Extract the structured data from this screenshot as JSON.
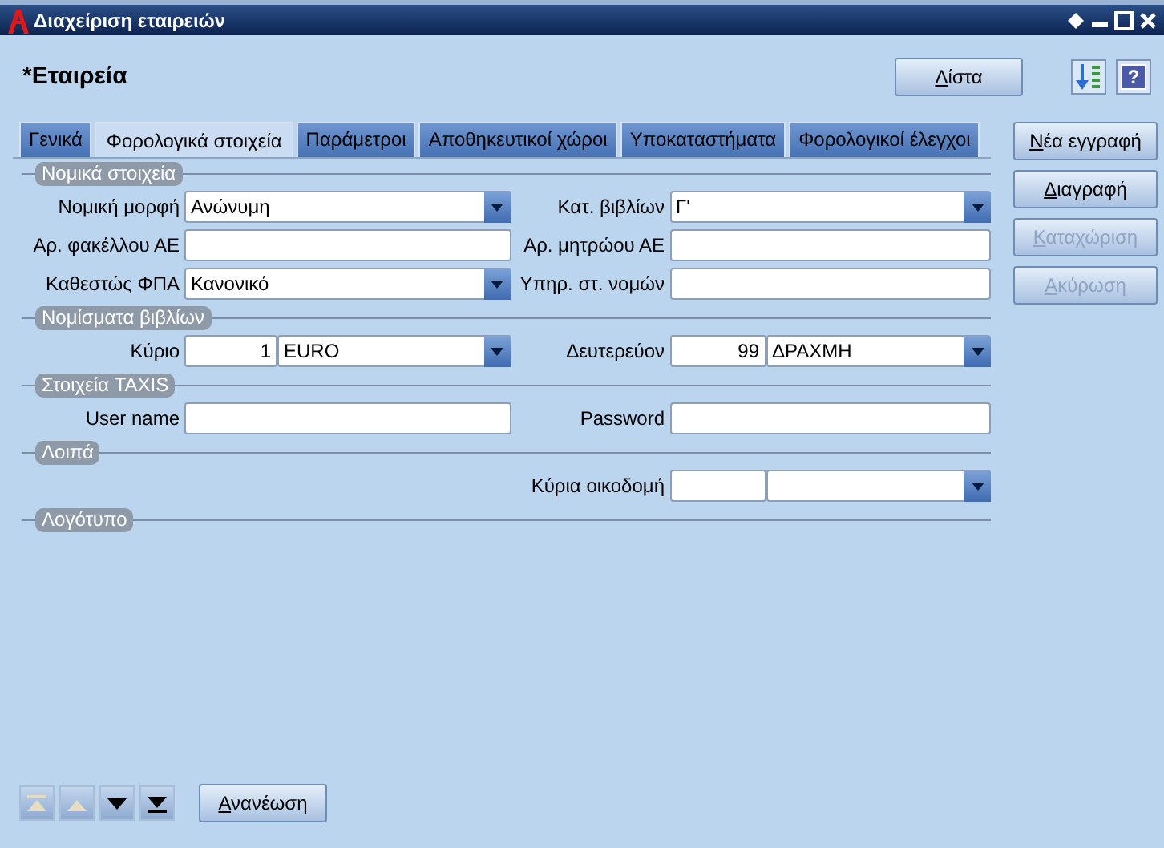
{
  "window": {
    "title": "Διαχείριση εταιρειών"
  },
  "heading": "*Εταιρεία",
  "list_button": "Λίστα",
  "help_label": "?",
  "tabs": [
    {
      "label": "Γενικά",
      "selected": false
    },
    {
      "label": "Φορολογικά στοιχεία",
      "selected": true
    },
    {
      "label": "Παράμετροι",
      "selected": false
    },
    {
      "label": "Αποθηκευτικοί χώροι",
      "selected": false
    },
    {
      "label": "Υποκαταστήματα",
      "selected": false
    },
    {
      "label": "Φορολογικοί έλεγχοι",
      "selected": false
    }
  ],
  "sections": [
    {
      "title": "Νομικά στοιχεία",
      "rows": [
        {
          "left": {
            "label": "Νομική μορφή",
            "kind": "combo",
            "value": "Ανώνυμη"
          },
          "right": {
            "label": "Κατ. βιβλίων",
            "kind": "combo",
            "value": "Γ'"
          }
        },
        {
          "left": {
            "label": "Αρ. φακέλλου ΑΕ",
            "kind": "text"
          },
          "right": {
            "label": "Αρ. μητρώου ΑΕ",
            "kind": "text"
          }
        },
        {
          "left": {
            "label": "Καθεστώς ΦΠΑ",
            "kind": "combo",
            "value": "Κανονικό"
          },
          "right": {
            "label": "Υπηρ. στ. νομών",
            "kind": "text"
          }
        }
      ]
    },
    {
      "title": "Νομίσματα βιβλίων",
      "rows": [
        {
          "left": {
            "label": "Κύριο",
            "kind": "code_combo",
            "code": "1",
            "value": "EURO"
          },
          "right": {
            "label": "Δευτερεύον",
            "kind": "code_combo",
            "code": "99",
            "value": "ΔΡΑΧΜΗ"
          }
        }
      ]
    },
    {
      "title": "Στοιχεία TAXIS",
      "rows": [
        {
          "left": {
            "label": "User name",
            "kind": "text"
          },
          "right": {
            "label": "Password",
            "kind": "text"
          }
        }
      ]
    },
    {
      "title": "Λοιπά",
      "rows": [
        {
          "right": {
            "label": "Κύρια οικοδομή",
            "kind": "code_combo"
          }
        }
      ]
    },
    {
      "title": "Λογότυπο"
    }
  ],
  "actions": [
    {
      "label": "Νέα εγγραφή",
      "disabled": false
    },
    {
      "label": "Διαγραφή",
      "disabled": false
    },
    {
      "label": "Καταχώριση",
      "disabled": true
    },
    {
      "label": "Ακύρωση",
      "disabled": true
    }
  ],
  "navigator": [
    {
      "kind": "first",
      "disabled": true
    },
    {
      "kind": "prev",
      "disabled": true
    },
    {
      "kind": "next",
      "disabled": false
    },
    {
      "kind": "last",
      "disabled": false
    }
  ],
  "refresh_button": "Ανανέωση"
}
